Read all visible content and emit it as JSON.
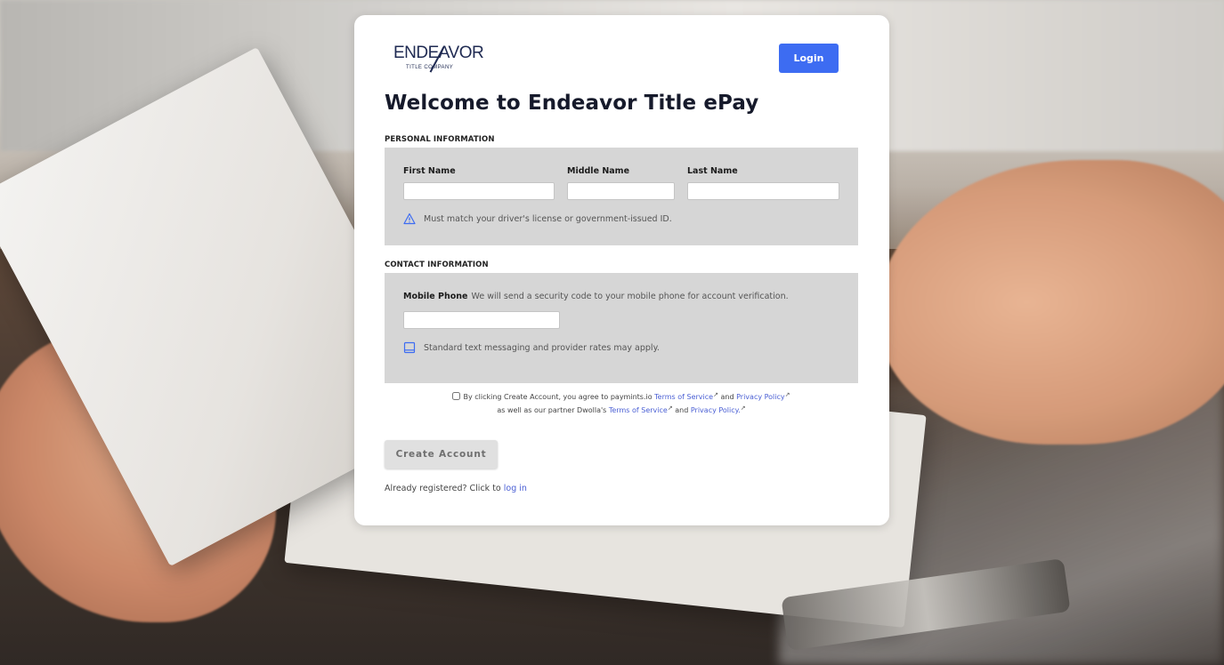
{
  "brand": {
    "logo_main": "ENDEAVOR",
    "logo_sub": "TITLE COMPANY",
    "accent_color": "#3d6cf2",
    "link_color": "#4a5fd4"
  },
  "header": {
    "login_label": "Login",
    "title": "Welcome to Endeavor Title ePay"
  },
  "personal": {
    "section_label": "PERSONAL INFORMATION",
    "first_name_label": "First Name",
    "first_name_value": "",
    "middle_name_label": "Middle Name",
    "middle_name_value": "",
    "last_name_label": "Last Name",
    "last_name_value": "",
    "hint_icon": "warning-triangle-icon",
    "hint": "Must match your driver's license or government-issued ID."
  },
  "contact": {
    "section_label": "CONTACT INFORMATION",
    "mobile_label": "Mobile Phone",
    "mobile_desc": "We will send a security code to your mobile phone for account verification.",
    "mobile_value": "",
    "hint_icon": "mobile-phone-icon",
    "hint": "Standard text messaging and provider rates may apply."
  },
  "agreement": {
    "checked": false,
    "text_1": "By clicking Create Account, you agree to paymints.io",
    "tos_1": "Terms of Service",
    "and_1": "and",
    "privacy_1": "Privacy Policy",
    "text_2": "as well as our partner Dwolla's",
    "tos_2": "Terms of Service",
    "and_2": "and",
    "privacy_2": "Privacy Policy.",
    "external_link_icon": "external-link-icon"
  },
  "actions": {
    "create_account_label": "Create Account",
    "already_text": "Already registered? Click to",
    "login_link": "log in"
  }
}
